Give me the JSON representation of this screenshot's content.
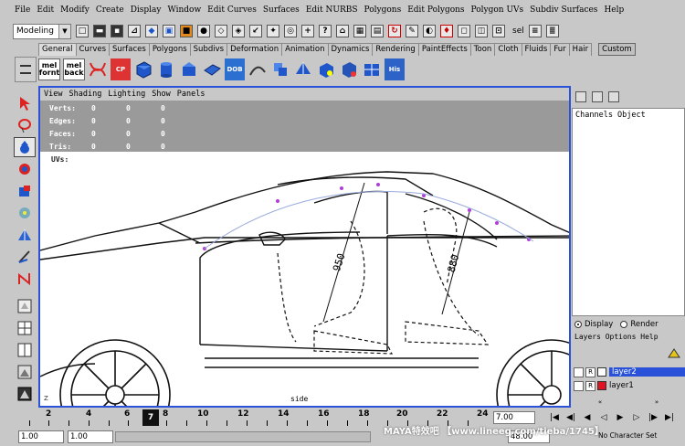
{
  "menubar": [
    "File",
    "Edit",
    "Modify",
    "Create",
    "Display",
    "Window",
    "Edit Curves",
    "Surfaces",
    "Edit NURBS",
    "Polygons",
    "Edit Polygons",
    "Polygon UVs",
    "Subdiv Surfaces",
    "Help"
  ],
  "statusline": {
    "mode": "Modeling",
    "sel_label": "sel"
  },
  "shelf_tabs": [
    "General",
    "Curves",
    "Surfaces",
    "Polygons",
    "Subdivs",
    "Deformation",
    "Animation",
    "Dynamics",
    "Rendering",
    "PaintEffects",
    "Toon",
    "Cloth",
    "Fluids",
    "Fur",
    "Hair",
    "Custom"
  ],
  "shelf": {
    "mel1": [
      "mel",
      "fornt"
    ],
    "mel2": [
      "mel",
      "back"
    ],
    "cp": "CP",
    "dob": "DOB",
    "his": "His"
  },
  "viewport": {
    "menu": [
      "View",
      "Shading",
      "Lighting",
      "Show",
      "Panels"
    ],
    "hud": [
      {
        "label": "Verts:",
        "values": [
          "0",
          "0",
          "0"
        ]
      },
      {
        "label": "Edges:",
        "values": [
          "0",
          "0",
          "0"
        ]
      },
      {
        "label": "Faces:",
        "values": [
          "0",
          "0",
          "0"
        ]
      },
      {
        "label": "Tris:",
        "values": [
          "0",
          "0",
          "0"
        ]
      }
    ],
    "uvs_label": "UVs:",
    "camera": "side",
    "axis": "Z",
    "dimension_labels": [
      "950",
      "880"
    ]
  },
  "channels": {
    "header": "Channels Object"
  },
  "display_render": {
    "display": "Display",
    "render": "Render",
    "selected": "display"
  },
  "layers": {
    "menu": "Layers Options Help",
    "items": [
      {
        "name": "layer2",
        "flag": "R",
        "color": "#ffffff",
        "selected": true
      },
      {
        "name": "layer1",
        "flag": "R",
        "color": "#e0141e",
        "selected": false
      }
    ]
  },
  "timeline": {
    "ticks": [
      "2",
      "4",
      "6",
      "8",
      "10",
      "12",
      "14",
      "16",
      "18",
      "20",
      "22",
      "24"
    ],
    "current_frame": "7",
    "current_time": "7.00"
  },
  "range": {
    "start": "1.00",
    "start2": "1.00",
    "end_field": "48.00",
    "character_set": "No Character Set"
  },
  "watermark": "MAYA特效吧 【www.lineeg.com/tieba/1745】"
}
